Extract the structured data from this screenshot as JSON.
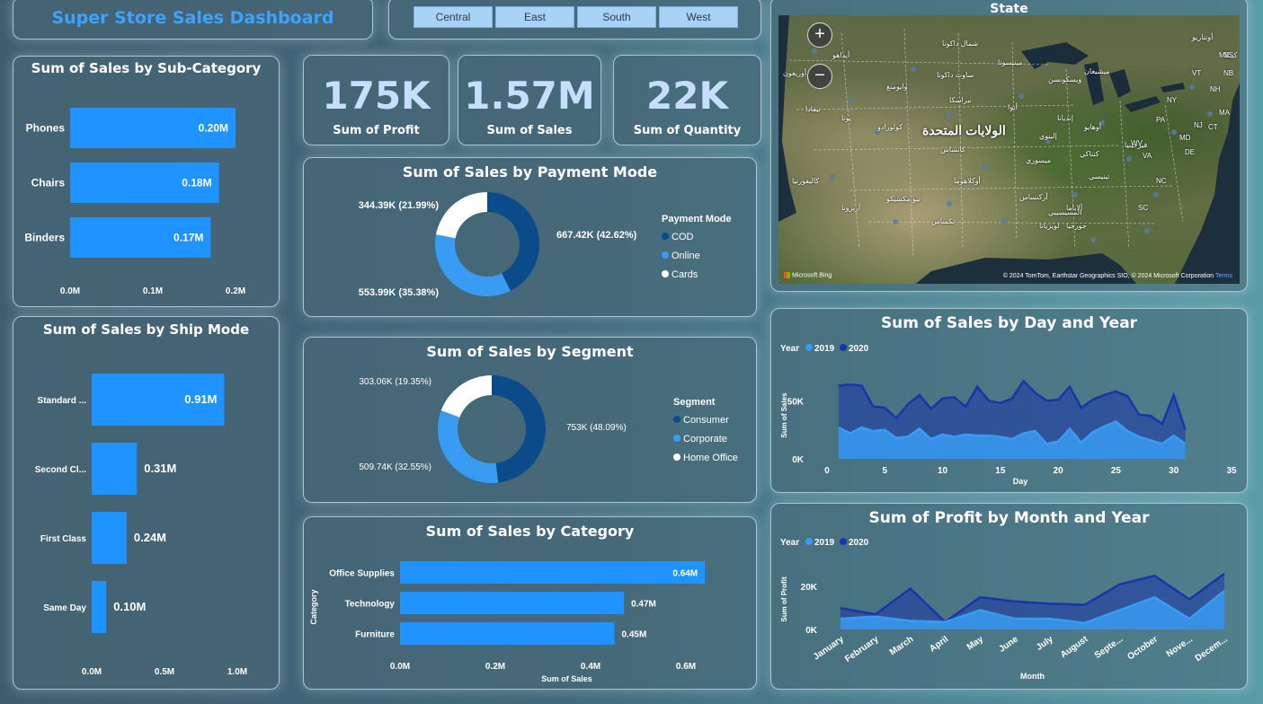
{
  "header": {
    "title": "Super Store Sales Dashboard"
  },
  "slicer": {
    "options": [
      "Central",
      "East",
      "South",
      "West"
    ]
  },
  "kpis": [
    {
      "value": "175K",
      "label": "Sum of Profit"
    },
    {
      "value": "1.57M",
      "label": "Sum of Sales"
    },
    {
      "value": "22K",
      "label": "Sum of Quantity"
    }
  ],
  "map": {
    "title": "State",
    "zoom_in": "+",
    "zoom_out": "−",
    "country_label": "الولايات المتحدة",
    "bing_logo": "Microsoft Bing",
    "attribution": "© 2024 TomTom, Earthstar Geographics SIO, © 2024 Microsoft Corporation",
    "terms": "Terms",
    "state_labels": [
      {
        "text": "شمال داكوتا"
      },
      {
        "text": "مينيسوتا"
      },
      {
        "text": "ساوث داكوتا"
      },
      {
        "text": "ويسكونسن"
      },
      {
        "text": "ميشيغان"
      },
      {
        "text": "نبراسكا"
      },
      {
        "text": "أيوا"
      },
      {
        "text": "إلينوي"
      },
      {
        "text": "أوهايو"
      },
      {
        "text": "كانساس"
      },
      {
        "text": "ميسوري"
      },
      {
        "text": "كنتاكي"
      },
      {
        "text": "تينيسي"
      },
      {
        "text": "أوكلاهوما"
      },
      {
        "text": "أركنساس"
      },
      {
        "text": "تكساس"
      },
      {
        "text": "لويزيانا"
      },
      {
        "text": "جورجيا"
      },
      {
        "text": "كولورادو"
      },
      {
        "text": "يوتا"
      },
      {
        "text": "نيفادا"
      },
      {
        "text": "كاليفورنيا"
      },
      {
        "text": "أريزونا"
      },
      {
        "text": "نيو مكسيكو"
      },
      {
        "text": "أوريغون"
      },
      {
        "text": "أيداهو"
      },
      {
        "text": "وايومنغ"
      },
      {
        "text": "إنديانا"
      },
      {
        "text": "ألاباما"
      },
      {
        "text": "المسيسيبي"
      },
      {
        "text": "فيرجينيا"
      },
      {
        "text": "أونتاريو"
      },
      {
        "text": "كيبك"
      },
      {
        "text": "NY"
      },
      {
        "text": "PA"
      },
      {
        "text": "VT"
      },
      {
        "text": "NH"
      },
      {
        "text": "ME"
      },
      {
        "text": "MA"
      },
      {
        "text": "CT"
      },
      {
        "text": "NJ"
      },
      {
        "text": "DE"
      },
      {
        "text": "MD"
      },
      {
        "text": "NC"
      },
      {
        "text": "SC"
      },
      {
        "text": "VA"
      },
      {
        "text": "WV"
      },
      {
        "text": "NS"
      },
      {
        "text": "NB"
      }
    ]
  },
  "chart_data": [
    {
      "id": "sales-by-subcategory",
      "type": "bar",
      "orientation": "horizontal",
      "title": "Sum of Sales by Sub-Category",
      "categories": [
        "Phones",
        "Chairs",
        "Binders"
      ],
      "values": [
        0.2,
        0.18,
        0.17
      ],
      "data_labels": [
        "0.20M",
        "0.18M",
        "0.17M"
      ],
      "xlim": [
        0,
        0.2
      ],
      "xticks": [
        "0.0M",
        "0.1M",
        "0.2M"
      ],
      "color": "#1f93ff"
    },
    {
      "id": "sales-by-shipmode",
      "type": "bar",
      "orientation": "horizontal",
      "title": "Sum of Sales by Ship Mode",
      "categories": [
        "Standard ...",
        "Second Cl...",
        "First Class",
        "Same Day"
      ],
      "values": [
        0.91,
        0.31,
        0.24,
        0.1
      ],
      "data_labels": [
        "0.91M",
        "0.31M",
        "0.24M",
        "0.10M"
      ],
      "xlim": [
        0,
        1.0
      ],
      "xticks": [
        "0.0M",
        "0.5M",
        "1.0M"
      ],
      "color": "#1f93ff"
    },
    {
      "id": "sales-by-payment",
      "type": "pie",
      "donut": true,
      "title": "Sum of Sales by Payment Mode",
      "legend_title": "Payment Mode",
      "slices": [
        {
          "name": "COD",
          "value": 667.42,
          "label": "667.42K (42.62%)",
          "color": "#0c4b8a"
        },
        {
          "name": "Online",
          "value": 553.99,
          "label": "553.99K (35.38%)",
          "color": "#3a9bf2"
        },
        {
          "name": "Cards",
          "value": 344.39,
          "label": "344.39K (21.99%)",
          "color": "#ffffff"
        }
      ]
    },
    {
      "id": "sales-by-segment",
      "type": "pie",
      "donut": true,
      "title": "Sum of Sales by Segment",
      "legend_title": "Segment",
      "slices": [
        {
          "name": "Consumer",
          "value": 753.0,
          "label": "753K (48.09%)",
          "color": "#0c4b8a"
        },
        {
          "name": "Corporate",
          "value": 509.74,
          "label": "509.74K (32.55%)",
          "color": "#3a9bf2"
        },
        {
          "name": "Home Office",
          "value": 303.06,
          "label": "303.06K (19.35%)",
          "color": "#ffffff"
        }
      ]
    },
    {
      "id": "sales-by-category",
      "type": "bar",
      "orientation": "horizontal",
      "title": "Sum of Sales by Category",
      "xlabel": "Sum of Sales",
      "ylabel": "Category",
      "categories": [
        "Office Supplies",
        "Technology",
        "Furniture"
      ],
      "values": [
        0.64,
        0.47,
        0.45
      ],
      "data_labels": [
        "0.64M",
        "0.47M",
        "0.45M"
      ],
      "xlim": [
        0,
        0.7
      ],
      "xticks": [
        "0.0M",
        "0.2M",
        "0.4M",
        "0.6M"
      ],
      "xtick_values": [
        0,
        0.2,
        0.4,
        0.6
      ],
      "color": "#1f93ff"
    },
    {
      "id": "sales-by-day-year",
      "type": "area",
      "title": "Sum of Sales by Day and Year",
      "xlabel": "Day",
      "ylabel": "Sum of Sales",
      "legend_title": "Year",
      "xlim": [
        0,
        35
      ],
      "xticks": [
        0,
        5,
        10,
        15,
        20,
        25,
        30,
        35
      ],
      "ylim": [
        0,
        75000
      ],
      "yticks": [
        {
          "v": 0,
          "label": "0K"
        },
        {
          "v": 50000,
          "label": "50K"
        }
      ],
      "x": [
        1,
        2,
        3,
        4,
        5,
        6,
        7,
        8,
        9,
        10,
        11,
        12,
        13,
        14,
        15,
        16,
        17,
        18,
        19,
        20,
        21,
        22,
        23,
        24,
        25,
        26,
        27,
        28,
        29,
        30,
        31
      ],
      "series": [
        {
          "name": "2019",
          "color": "#3a9bf2",
          "values": [
            27000,
            22000,
            27000,
            24000,
            25000,
            18000,
            19000,
            26000,
            17000,
            21000,
            19000,
            21000,
            20000,
            20000,
            19000,
            17000,
            22000,
            24000,
            13000,
            15000,
            26000,
            14000,
            23000,
            28000,
            32000,
            24000,
            19000,
            16000,
            13000,
            20000,
            13000
          ]
        },
        {
          "name": "2020",
          "color": "#1a35a8",
          "values": [
            63000,
            64000,
            63000,
            45000,
            44000,
            35000,
            47000,
            55000,
            43000,
            52000,
            53000,
            45000,
            62000,
            50000,
            48000,
            52000,
            67000,
            57000,
            50000,
            51000,
            62000,
            44000,
            51000,
            55000,
            58000,
            54000,
            38000,
            37000,
            30000,
            55000,
            25000
          ]
        }
      ]
    },
    {
      "id": "profit-by-month-year",
      "type": "area",
      "title": "Sum of Profit by Month and Year",
      "xlabel": "Month",
      "ylabel": "Sum of Profit",
      "legend_title": "Year",
      "categories": [
        "January",
        "February",
        "March",
        "April",
        "May",
        "June",
        "July",
        "August",
        "Septe...",
        "October",
        "Nove...",
        "Decem..."
      ],
      "ylim": [
        0,
        28000
      ],
      "yticks": [
        {
          "v": 0,
          "label": "0K"
        },
        {
          "v": 20000,
          "label": "20K"
        }
      ],
      "series": [
        {
          "name": "2019",
          "color": "#3a9bf2",
          "values": [
            5000,
            6000,
            4000,
            3500,
            9000,
            5000,
            5000,
            3000,
            9000,
            15000,
            5000,
            18000
          ]
        },
        {
          "name": "2020",
          "color": "#1a35a8",
          "values": [
            10000,
            7000,
            19000,
            3500,
            15000,
            13000,
            12000,
            11500,
            21000,
            25000,
            14000,
            26000
          ]
        }
      ]
    }
  ]
}
